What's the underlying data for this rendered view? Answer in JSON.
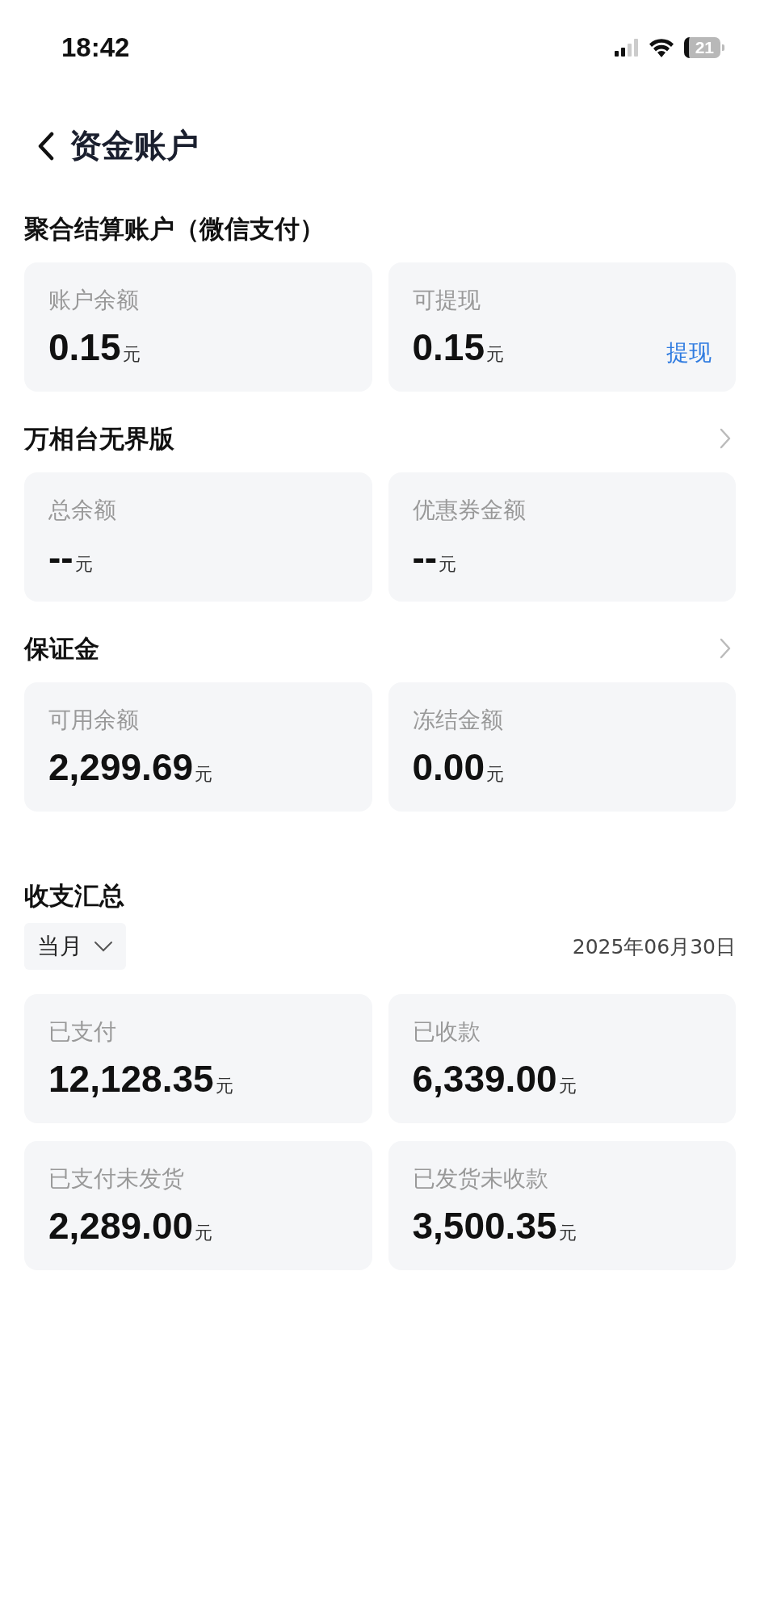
{
  "status_bar": {
    "time": "18:42",
    "battery": "21"
  },
  "header": {
    "title": "资金账户"
  },
  "sections": [
    {
      "title": "聚合结算账户（微信支付）",
      "has_arrow": false,
      "cards": [
        {
          "label": "账户余额",
          "amount": "0.15",
          "unit": "元"
        },
        {
          "label": "可提现",
          "amount": "0.15",
          "unit": "元",
          "action": "提现"
        }
      ]
    },
    {
      "title": "万相台无界版",
      "has_arrow": true,
      "cards": [
        {
          "label": "总余额",
          "amount": "--",
          "unit": "元"
        },
        {
          "label": "优惠券金额",
          "amount": "--",
          "unit": "元"
        }
      ]
    },
    {
      "title": "保证金",
      "has_arrow": true,
      "cards": [
        {
          "label": "可用余额",
          "amount": "2,299.69",
          "unit": "元"
        },
        {
          "label": "冻结金额",
          "amount": "0.00",
          "unit": "元"
        }
      ]
    }
  ],
  "summary": {
    "title": "收支汇总",
    "period": "当月",
    "date": "2025年06月30日",
    "cards": [
      {
        "label": "已支付",
        "amount": "12,128.35",
        "unit": "元"
      },
      {
        "label": "已收款",
        "amount": "6,339.00",
        "unit": "元"
      },
      {
        "label": "已支付未发货",
        "amount": "2,289.00",
        "unit": "元"
      },
      {
        "label": "已发货未收款",
        "amount": "3,500.35",
        "unit": "元"
      }
    ]
  }
}
